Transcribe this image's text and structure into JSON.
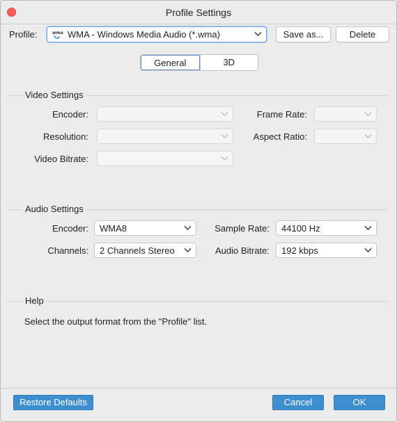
{
  "window": {
    "title": "Profile Settings"
  },
  "profile": {
    "label": "Profile:",
    "selected": "WMA - Windows Media Audio (*.wma)",
    "icon": "wma-file-icon",
    "save_label": "Save as...",
    "delete_label": "Delete"
  },
  "tabs": [
    {
      "label": "General",
      "active": true
    },
    {
      "label": "3D",
      "active": false
    }
  ],
  "video": {
    "title": "Video Settings",
    "encoder_label": "Encoder:",
    "encoder_value": "",
    "frame_rate_label": "Frame Rate:",
    "frame_rate_value": "",
    "resolution_label": "Resolution:",
    "resolution_value": "",
    "aspect_ratio_label": "Aspect Ratio:",
    "aspect_ratio_value": "",
    "bitrate_label": "Video Bitrate:",
    "bitrate_value": ""
  },
  "audio": {
    "title": "Audio Settings",
    "encoder_label": "Encoder:",
    "encoder_value": "WMA8",
    "sample_rate_label": "Sample Rate:",
    "sample_rate_value": "44100 Hz",
    "channels_label": "Channels:",
    "channels_value": "2 Channels Stereo",
    "bitrate_label": "Audio Bitrate:",
    "bitrate_value": "192 kbps"
  },
  "help": {
    "title": "Help",
    "text": "Select the output format from the \"Profile\" list."
  },
  "footer": {
    "restore_label": "Restore Defaults",
    "cancel_label": "Cancel",
    "ok_label": "OK"
  },
  "colors": {
    "accent_button": "#3d8fcf",
    "close_button": "#ff5f57",
    "window_bg": "#ececec"
  }
}
